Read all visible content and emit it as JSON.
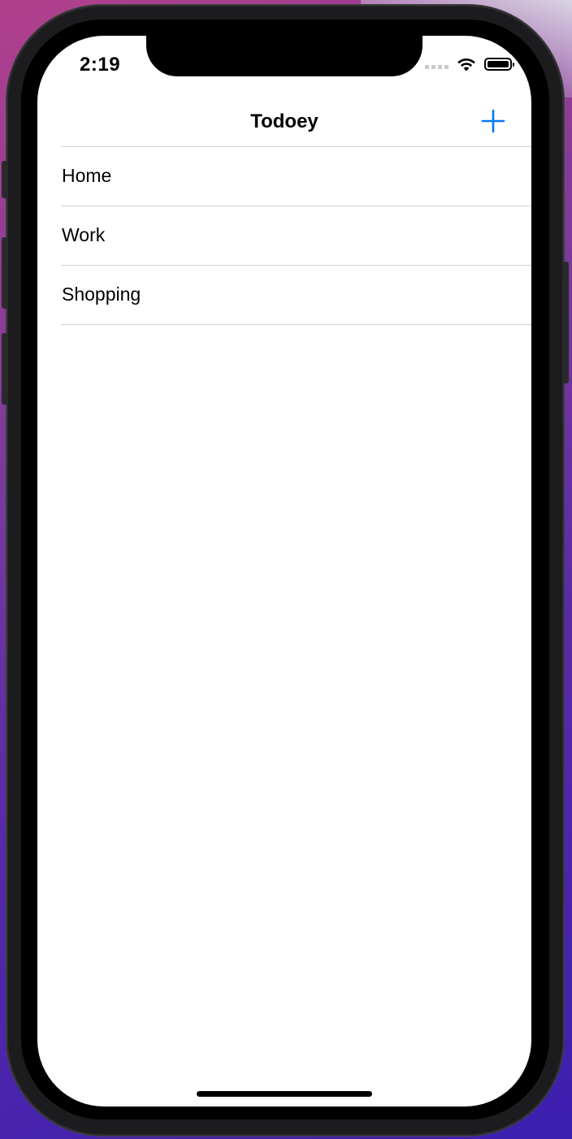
{
  "status_bar": {
    "time": "2:19",
    "wifi_icon": "wifi-icon",
    "battery_icon": "battery-icon",
    "signal_icon": "cellular-signal-icon"
  },
  "nav": {
    "title": "Todoey",
    "add_icon": "plus-icon"
  },
  "list": {
    "items": [
      {
        "label": "Home"
      },
      {
        "label": "Work"
      },
      {
        "label": "Shopping"
      }
    ]
  },
  "colors": {
    "accent": "#007aff",
    "separator": "#d1d1d6"
  }
}
